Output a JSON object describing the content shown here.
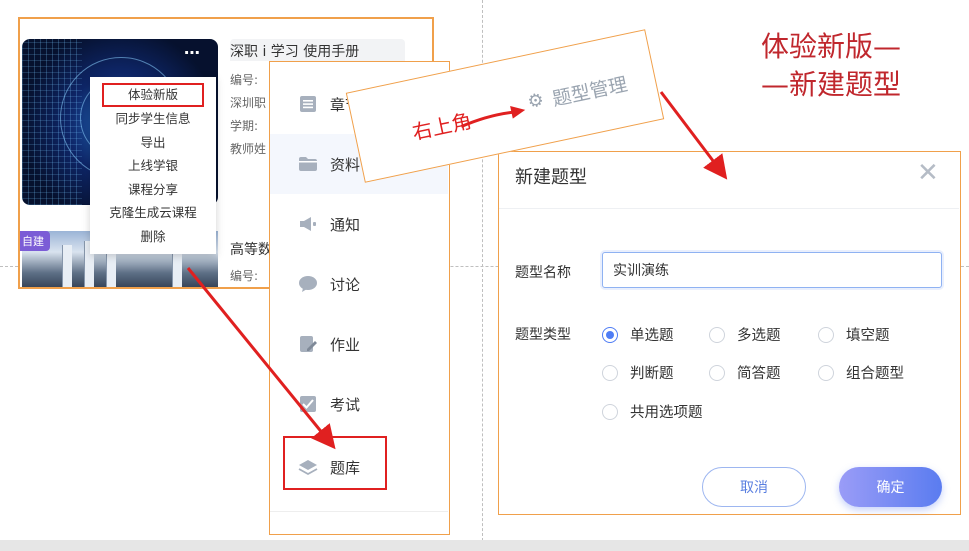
{
  "course_card": {
    "title": "深职 i 学习 使用手册",
    "info": [
      "编号:",
      "深圳职",
      "学期:",
      "教师姓"
    ],
    "more_icon": "⋯",
    "title2": "高等数",
    "info2": "编号:",
    "badge": "自建"
  },
  "context_menu": {
    "items": [
      "体验新版",
      "同步学生信息",
      "导出",
      "上线学银",
      "课程分享",
      "克隆生成云课程",
      "删除"
    ]
  },
  "sidebar": {
    "items": [
      {
        "label": "章节",
        "icon": "list-icon"
      },
      {
        "label": "资料",
        "icon": "folder-icon"
      },
      {
        "label": "通知",
        "icon": "megaphone-icon"
      },
      {
        "label": "讨论",
        "icon": "chat-bubble-icon"
      },
      {
        "label": "作业",
        "icon": "edit-document-icon"
      },
      {
        "label": "考试",
        "icon": "exam-icon"
      },
      {
        "label": "题库",
        "icon": "layers-icon"
      }
    ]
  },
  "callout": {
    "left_text": "右上角",
    "right_text": "题型管理",
    "gear_icon": "⚙"
  },
  "annotation": {
    "line1": "体验新版—",
    "line2": "—新建题型"
  },
  "dialog": {
    "title": "新建题型",
    "close_icon": "✕",
    "name_label": "题型名称",
    "name_value": "实训演练",
    "type_label": "题型类型",
    "options": [
      "单选题",
      "多选题",
      "填空题",
      "判断题",
      "简答题",
      "组合题型",
      "共用选项题"
    ],
    "selected": "单选题",
    "cancel_label": "取消",
    "ok_label": "确定"
  },
  "colors": {
    "accent": "#4f7df5",
    "annotation_red": "#c0272d",
    "frame_orange": "#f0a04b",
    "highlight_red": "#e02020"
  }
}
